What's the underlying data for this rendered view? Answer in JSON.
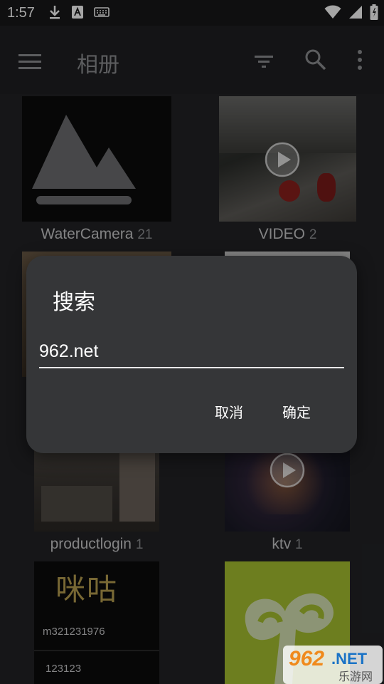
{
  "status_bar": {
    "time": "1:57"
  },
  "app_bar": {
    "title": "相册"
  },
  "albums": [
    {
      "name": "WaterCamera",
      "count": "21"
    },
    {
      "name": "VIDEO",
      "count": "2"
    },
    {
      "name": "productlogin",
      "count": "1"
    },
    {
      "name": "ktv",
      "count": "1"
    }
  ],
  "thumbnails": {
    "migu_text": "咪咕",
    "migu_sub": "m321231976",
    "migu_num": "123123"
  },
  "dialog": {
    "title": "搜索",
    "input_value": "962.net",
    "cancel_label": "取消",
    "ok_label": "确定"
  },
  "watermark": {
    "brand": "962",
    "net": ".NET",
    "site": "乐游网"
  },
  "colors": {
    "background": "#1f2022",
    "dialog": "#353638",
    "accent": "#ffffff"
  }
}
